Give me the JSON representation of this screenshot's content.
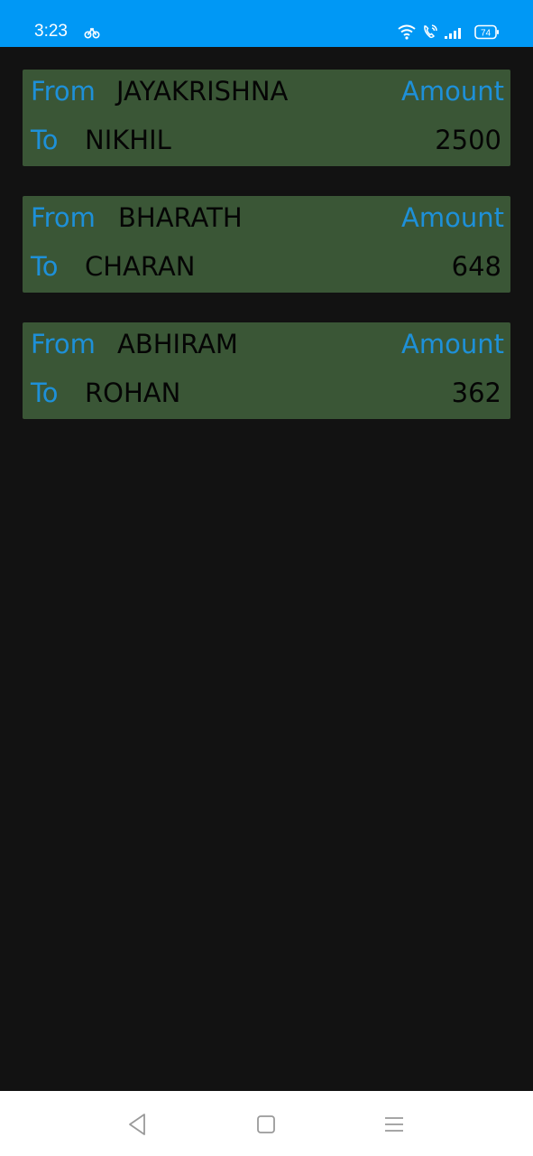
{
  "status_bar": {
    "time": "3:23",
    "battery": "74",
    "color": "#0098f5"
  },
  "labels": {
    "from": "From",
    "to": "To",
    "amount": "Amount"
  },
  "transactions": [
    {
      "from": "JAYAKRISHNA",
      "to": "NIKHIL",
      "amount": "2500"
    },
    {
      "from": "BHARATH",
      "to": "CHARAN",
      "amount": "648"
    },
    {
      "from": "ABHIRAM",
      "to": "ROHAN",
      "amount": "362"
    }
  ],
  "nav_bar": {
    "icons": [
      "back-icon",
      "home-icon",
      "menu-icon"
    ]
  },
  "colors": {
    "background": "#121212",
    "card": "#3a5636",
    "label_blue": "#1e90d8",
    "value_text": "#050505"
  }
}
